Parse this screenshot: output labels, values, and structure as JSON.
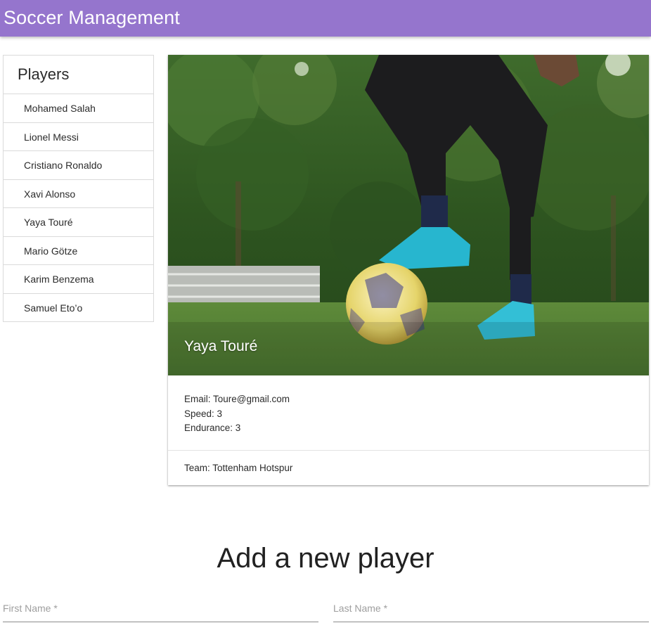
{
  "app": {
    "title": "Soccer Management",
    "accent_color": "#9575cd"
  },
  "sidebar": {
    "heading": "Players",
    "items": [
      {
        "label": "Mohamed Salah"
      },
      {
        "label": "Lionel Messi"
      },
      {
        "label": "Cristiano Ronaldo"
      },
      {
        "label": "Xavi Alonso"
      },
      {
        "label": "Yaya Touré"
      },
      {
        "label": "Mario Götze"
      },
      {
        "label": "Karim Benzema"
      },
      {
        "label": "Samuel Eto’o"
      }
    ]
  },
  "player_card": {
    "name": "Yaya Touré",
    "email": "Email: Toure@gmail.com",
    "speed": "Speed: 3",
    "endurance": "Endurance: 3",
    "team": "Team: Tottenham Hotspur"
  },
  "add_player": {
    "title": "Add a new player",
    "first_name_placeholder": "First Name *",
    "last_name_placeholder": "Last Name *"
  }
}
